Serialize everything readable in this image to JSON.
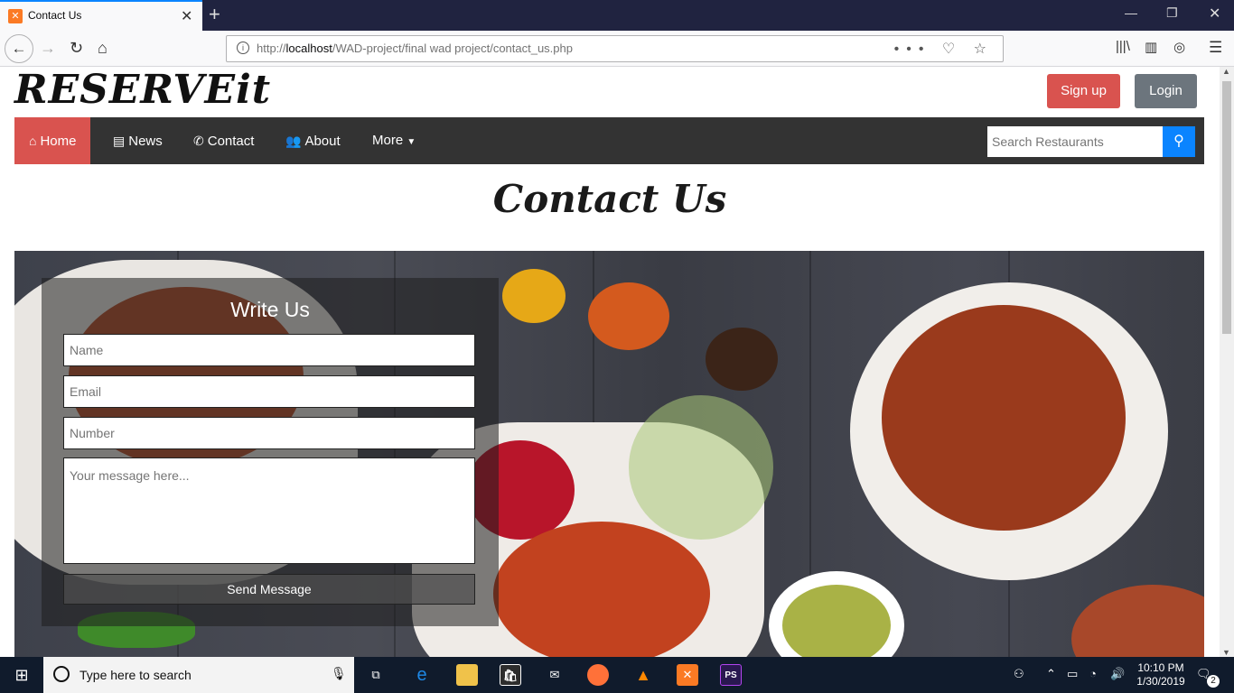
{
  "browser": {
    "tab_title": "Contact Us",
    "url_prefix": "http://",
    "url_host": "localhost",
    "url_path": "/WAD-project/final wad project/contact_us.php"
  },
  "site": {
    "logo": "RESERVEit",
    "signup_label": "Sign up",
    "login_label": "Login"
  },
  "menu": {
    "items": [
      {
        "label": "Home",
        "icon": "home-icon"
      },
      {
        "label": "News",
        "icon": "newspaper-icon"
      },
      {
        "label": "Contact",
        "icon": "phone-icon"
      },
      {
        "label": "About",
        "icon": "users-icon"
      },
      {
        "label": "More",
        "icon": "caret-down-icon"
      }
    ],
    "search_placeholder": "Search Restaurants"
  },
  "page": {
    "title": "Contact Us"
  },
  "form": {
    "title": "Write Us",
    "name_placeholder": "Name",
    "email_placeholder": "Email",
    "number_placeholder": "Number",
    "message_placeholder": "Your message here...",
    "send_label": "Send Message"
  },
  "taskbar": {
    "search_text": "Type here to search",
    "time": "10:10 PM",
    "date": "1/30/2019",
    "notifications": "2"
  },
  "colors": {
    "accent_red": "#d9534f",
    "nav_dark": "#333333",
    "search_blue": "#0a84ff",
    "login_gray": "#6c757d"
  }
}
